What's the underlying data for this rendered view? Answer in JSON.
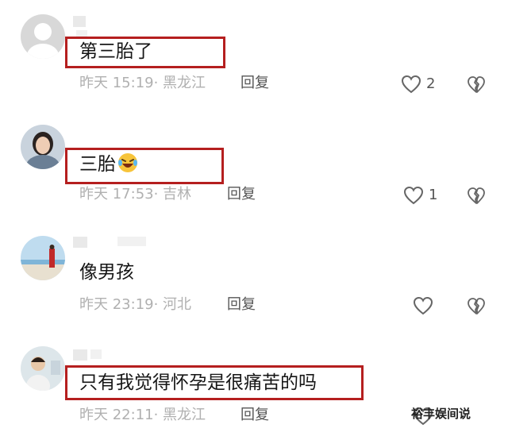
{
  "comments": [
    {
      "text": "第三胎了",
      "meta": "昨天 15:19· 黑龙江",
      "reply_label": "回复",
      "likes": "2"
    },
    {
      "text": "三胎",
      "emoji": "laughing-crying-emoji",
      "meta": "昨天 17:53· 吉林",
      "reply_label": "回复",
      "likes": "1"
    },
    {
      "text": "像男孩",
      "meta": "昨天 23:19· 河北",
      "reply_label": "回复",
      "likes": ""
    },
    {
      "text": "只有我觉得怀孕是很痛苦的吗",
      "meta": "昨天 22:11· 黑龙江",
      "reply_label": "回复",
      "likes": ""
    }
  ],
  "watermark": "裕丰娱间说",
  "colors": {
    "highlight_box": "#b51f1f",
    "meta_text": "#b0b0b0",
    "body_text": "#161616"
  },
  "icons": [
    "like-heart-icon",
    "dislike-broken-heart-icon"
  ]
}
